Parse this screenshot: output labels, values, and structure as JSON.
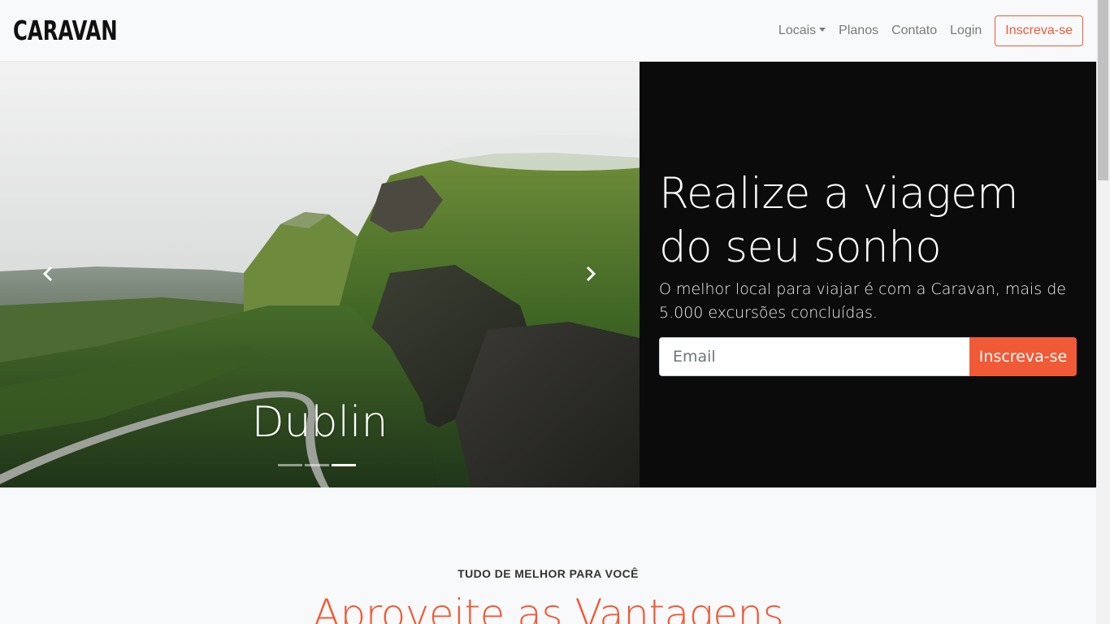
{
  "navbar": {
    "brand": "CARAVAN",
    "links": [
      {
        "label": "Locais",
        "dropdown": true
      },
      {
        "label": "Planos"
      },
      {
        "label": "Contato"
      },
      {
        "label": "Login"
      }
    ],
    "cta_label": "Inscreva-se"
  },
  "carousel": {
    "caption": "Dublin",
    "prev_icon": "chevron-left-icon",
    "next_icon": "chevron-right-icon",
    "indicators": 3,
    "active_indicator": 3
  },
  "signup": {
    "title": "Realize a viagem do seu sonho",
    "subtitle": "O melhor local para viajar é com a Caravan, mais de 5.000 excursões concluídas.",
    "email_placeholder": "Email",
    "submit_label": "Inscreva-se"
  },
  "benefits": {
    "eyebrow": "TUDO DE MELHOR PARA VOCÊ",
    "title": "Aproveite as Vantagens"
  },
  "colors": {
    "accent": "#f05a36",
    "panel": "#0b0b0b",
    "background": "#f8f9fa"
  }
}
